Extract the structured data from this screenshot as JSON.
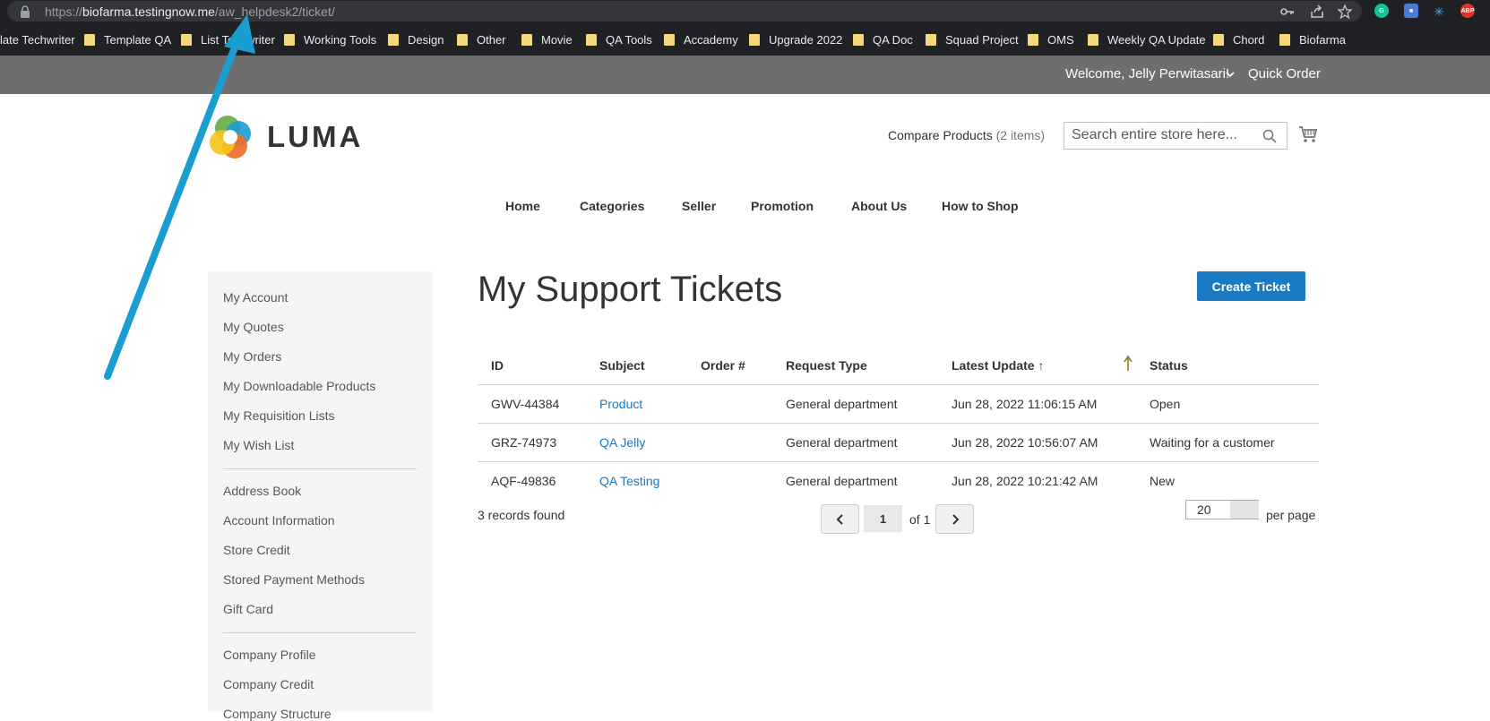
{
  "browser": {
    "url_scheme": "https://",
    "url_host": "biofarma.testingnow.me",
    "url_path": "/aw_helpdesk2/ticket/",
    "icons": [
      "key-icon",
      "share-icon",
      "star-icon",
      "grammarly-icon",
      "extension-icon",
      "sparkle-icon",
      "adblock-icon"
    ],
    "adblock_label": "ABP"
  },
  "bookmarks": [
    {
      "label": "late Techwriter",
      "has_folder": false
    },
    {
      "label": "Template QA",
      "has_folder": true
    },
    {
      "label": "List Techwriter",
      "has_folder": true
    },
    {
      "label": "Working Tools",
      "has_folder": true
    },
    {
      "label": "Design",
      "has_folder": true
    },
    {
      "label": "Other",
      "has_folder": true
    },
    {
      "label": "Movie",
      "has_folder": true
    },
    {
      "label": "QA Tools",
      "has_folder": true
    },
    {
      "label": "Accademy",
      "has_folder": true
    },
    {
      "label": "Upgrade 2022",
      "has_folder": true
    },
    {
      "label": "QA Doc",
      "has_folder": true
    },
    {
      "label": "Squad Project",
      "has_folder": true
    },
    {
      "label": "OMS",
      "has_folder": true
    },
    {
      "label": "Weekly QA Update",
      "has_folder": true
    },
    {
      "label": "Chord",
      "has_folder": true
    },
    {
      "label": "Biofarma",
      "has_folder": true
    }
  ],
  "header": {
    "welcome": "Welcome, Jelly Perwitasari!",
    "quick_order": "Quick Order",
    "logo_text": "LUMA",
    "compare_label": "Compare Products",
    "compare_count": "(2 items)",
    "search_placeholder": "Search entire store here..."
  },
  "nav": [
    "Home",
    "Categories",
    "Seller",
    "Promotion",
    "About Us",
    "How to Shop"
  ],
  "sidebar": {
    "group1": [
      "My Account",
      "My Quotes",
      "My Orders",
      "My Downloadable Products",
      "My Requisition Lists",
      "My Wish List"
    ],
    "group2": [
      "Address Book",
      "Account Information",
      "Store Credit",
      "Stored Payment Methods",
      "Gift Card"
    ],
    "group3": [
      "Company Profile",
      "Company Credit",
      "Company Structure"
    ]
  },
  "main": {
    "title": "My Support Tickets",
    "create_button": "Create Ticket",
    "columns": [
      "ID",
      "Subject",
      "Order #",
      "Request Type",
      "Latest Update",
      "Status"
    ],
    "sort_indicator": "↑",
    "rows": [
      {
        "id": "GWV-44384",
        "subject": "Product",
        "order": "",
        "request_type": "General department",
        "latest_update": "Jun 28, 2022 11:06:15 AM",
        "status": "Open"
      },
      {
        "id": "GRZ-74973",
        "subject": "QA Jelly",
        "order": "",
        "request_type": "General department",
        "latest_update": "Jun 28, 2022 10:56:07 AM",
        "status": "Waiting for a customer"
      },
      {
        "id": "AQF-49836",
        "subject": "QA Testing",
        "order": "",
        "request_type": "General department",
        "latest_update": "Jun 28, 2022 10:21:42 AM",
        "status": "New"
      }
    ],
    "records_found": "3 records found",
    "pager": {
      "current": "1",
      "of_label": "of 1"
    },
    "per_page": {
      "value": "20",
      "label": "per page"
    }
  },
  "colors": {
    "accent": "#1979c3",
    "annotation": "#1a9dd1"
  }
}
